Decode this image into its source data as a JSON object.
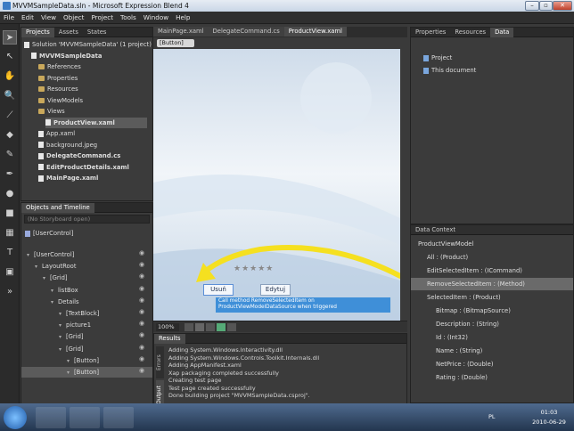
{
  "window": {
    "title": "MVVMSampleData.sln - Microsoft Expression Blend 4"
  },
  "menu": [
    "File",
    "Edit",
    "View",
    "Object",
    "Project",
    "Tools",
    "Window",
    "Help"
  ],
  "left_panel": {
    "tabs": [
      "Projects",
      "Assets",
      "States"
    ],
    "tree": [
      {
        "label": "Solution 'MVVMSampleData' (1 project)",
        "indent": 0,
        "kind": "sol",
        "bold": false
      },
      {
        "label": "MVVMSampleData",
        "indent": 1,
        "kind": "proj",
        "bold": true
      },
      {
        "label": "References",
        "indent": 2,
        "kind": "folder",
        "bold": false
      },
      {
        "label": "Properties",
        "indent": 2,
        "kind": "folder",
        "bold": false
      },
      {
        "label": "Resources",
        "indent": 2,
        "kind": "folder",
        "bold": false
      },
      {
        "label": "ViewModels",
        "indent": 2,
        "kind": "folder",
        "bold": false
      },
      {
        "label": "Views",
        "indent": 2,
        "kind": "folder",
        "bold": false
      },
      {
        "label": "ProductView.xaml",
        "indent": 3,
        "kind": "file",
        "bold": true,
        "selected": true
      },
      {
        "label": "App.xaml",
        "indent": 2,
        "kind": "file",
        "bold": false
      },
      {
        "label": "background.jpeg",
        "indent": 2,
        "kind": "file",
        "bold": false
      },
      {
        "label": "DelegateCommand.cs",
        "indent": 2,
        "kind": "file",
        "bold": true
      },
      {
        "label": "EditProductDetails.xaml",
        "indent": 2,
        "kind": "file",
        "bold": true
      },
      {
        "label": "MainPage.xaml",
        "indent": 2,
        "kind": "file",
        "bold": true
      }
    ]
  },
  "objects_panel": {
    "title": "Objects and Timeline",
    "storyboard": "(No Storyboard open)",
    "root": "[UserControl]",
    "tree": [
      {
        "label": "[UserControl]",
        "indent": 0
      },
      {
        "label": "LayoutRoot",
        "indent": 1
      },
      {
        "label": "[Grid]",
        "indent": 2
      },
      {
        "label": "listBox",
        "indent": 3
      },
      {
        "label": "Details",
        "indent": 3
      },
      {
        "label": "[TextBlock]",
        "indent": 4
      },
      {
        "label": "picture1",
        "indent": 4
      },
      {
        "label": "[Grid]",
        "indent": 4
      },
      {
        "label": "[Grid]",
        "indent": 4
      },
      {
        "label": "[Button]",
        "indent": 5
      },
      {
        "label": "[Button]",
        "indent": 5,
        "selected": true
      }
    ]
  },
  "doc_tabs": [
    "MainPage.xaml",
    "DelegateCommand.cs",
    "ProductView.xaml"
  ],
  "breadcrumb": "[Button]",
  "design": {
    "btn_remove": "Usuń",
    "btn_edit": "Edytuj",
    "tooltip": "Call method RemoveSelectedItem on ProductViewModelDataSource when triggered",
    "zoom": "100%"
  },
  "results": {
    "title": "Results",
    "side_tabs": [
      "Errors",
      "Output"
    ],
    "lines": [
      "Adding System.Windows.Interactivity.dll",
      "Adding System.Windows.Controls.Toolkit.Internals.dll",
      "Adding AppManifest.xaml",
      "Xap packaging completed successfully",
      "Creating test page",
      "Test page created successfully",
      "Done building project \"MVVMSampleData.csproj\"."
    ]
  },
  "right_panel": {
    "tabs": [
      "Properties",
      "Resources",
      "Data"
    ],
    "items": [
      "Project",
      "This document"
    ]
  },
  "data_context": {
    "title": "Data Context",
    "rows": [
      {
        "label": "ProductViewModel",
        "indent": 0
      },
      {
        "label": "All : (Product)",
        "indent": 1
      },
      {
        "label": "EditSelectedItem : (ICommand)",
        "indent": 1
      },
      {
        "label": "RemoveSelectedItem : (Method)",
        "indent": 1,
        "selected": true
      },
      {
        "label": "SelectedItem : (Product)",
        "indent": 1
      },
      {
        "label": "Bitmap : (BitmapSource)",
        "indent": 2
      },
      {
        "label": "Description : (String)",
        "indent": 2
      },
      {
        "label": "Id : (Int32)",
        "indent": 2
      },
      {
        "label": "Name : (String)",
        "indent": 2
      },
      {
        "label": "NetPrice : (Double)",
        "indent": 2
      },
      {
        "label": "Rating : (Double)",
        "indent": 2
      }
    ]
  },
  "taskbar": {
    "lang": "PL",
    "time": "01:03",
    "date": "2010-06-29"
  },
  "colors": {
    "accent": "#f5e020",
    "selection": "#5b5b5b",
    "tooltip": "#3f8fd8"
  }
}
